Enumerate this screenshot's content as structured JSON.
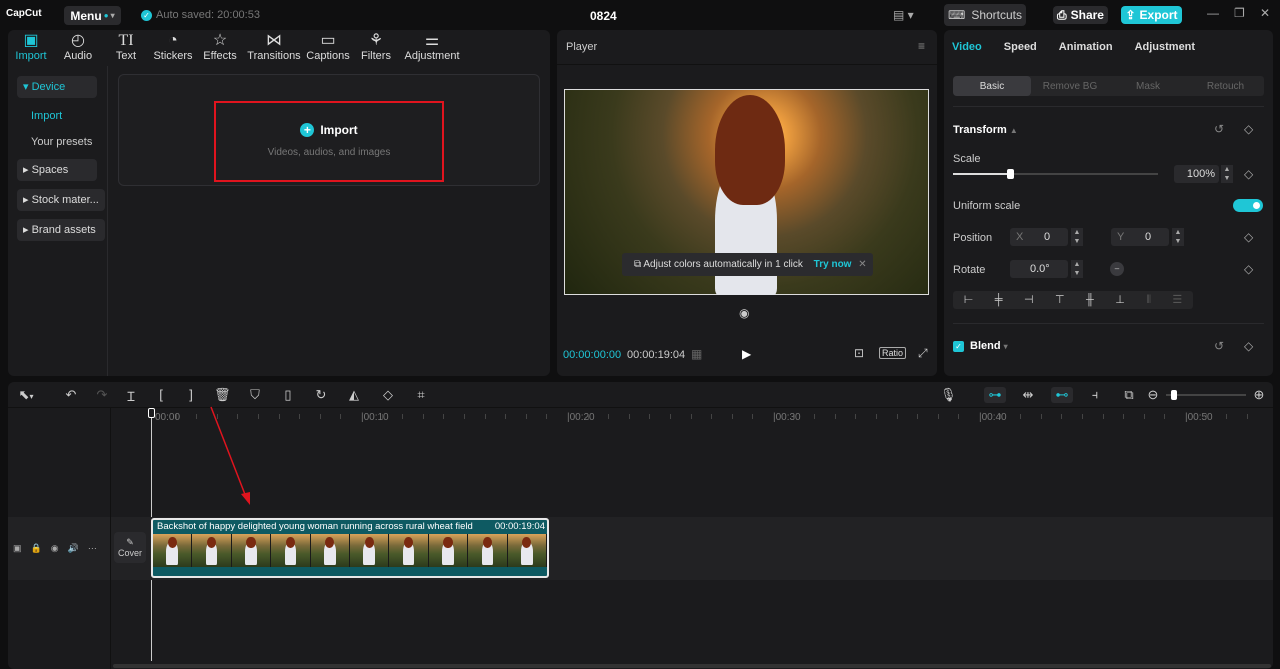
{
  "titlebar": {
    "app": "CapCut",
    "menu": "Menu",
    "autosave": "Auto saved: 20:00:53",
    "project": "0824",
    "shortcuts": "Shortcuts",
    "share": "Share",
    "export": "Export"
  },
  "media_tabs": [
    {
      "label": "Import",
      "icon": "import-icon"
    },
    {
      "label": "Audio",
      "icon": "audio-icon"
    },
    {
      "label": "Text",
      "icon": "text-icon"
    },
    {
      "label": "Stickers",
      "icon": "stickers-icon"
    },
    {
      "label": "Effects",
      "icon": "effects-icon"
    },
    {
      "label": "Transitions",
      "icon": "transitions-icon"
    },
    {
      "label": "Captions",
      "icon": "captions-icon"
    },
    {
      "label": "Filters",
      "icon": "filters-icon"
    },
    {
      "label": "Adjustment",
      "icon": "adjustment-icon"
    }
  ],
  "sidebar": {
    "device": "Device",
    "import": "Import",
    "presets": "Your presets",
    "spaces": "Spaces",
    "stock": "Stock mater...",
    "brand": "Brand assets"
  },
  "import_box": {
    "title": "Import",
    "subtitle": "Videos, audios, and images"
  },
  "player": {
    "title": "Player",
    "tip": "Adjust colors automatically in 1 click",
    "try_now": "Try now",
    "current_time": "00:00:00:00",
    "duration": "00:00:19:04",
    "ratio": "Ratio"
  },
  "inspector": {
    "tabs": [
      "Video",
      "Speed",
      "Animation",
      "Adjustment"
    ],
    "subtabs": [
      "Basic",
      "Remove BG",
      "Mask",
      "Retouch"
    ],
    "transform": "Transform",
    "scale": "Scale",
    "scale_value": "100%",
    "scale_fraction": 0.28,
    "uniform_scale": "Uniform scale",
    "uniform_on": true,
    "position": "Position",
    "x_label": "X",
    "x_value": "0",
    "y_label": "Y",
    "y_value": "0",
    "rotate": "Rotate",
    "rotate_value": "0.0°",
    "blend": "Blend"
  },
  "timeline": {
    "ticks": [
      "00:00",
      "00:10",
      "00:20",
      "00:30",
      "00:40",
      "00:50"
    ],
    "cover": "Cover",
    "clip_title": "Backshot of happy delighted young woman running across rural wheat field",
    "clip_duration": "00:00:19:04"
  },
  "colors": {
    "accent": "#1fc6d6",
    "clip": "#0e5a62",
    "highlight": "#e0141e"
  }
}
